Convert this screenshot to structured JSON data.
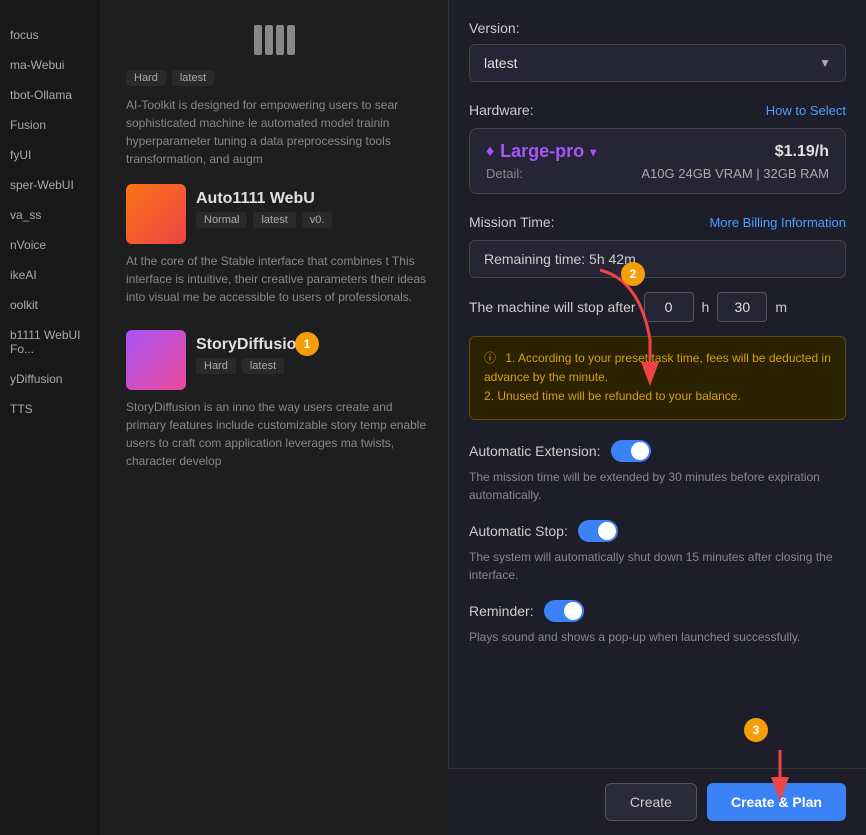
{
  "sidebar": {
    "items": [
      {
        "label": "focus"
      },
      {
        "label": "ma-Webui"
      },
      {
        "label": "tbot-Ollama"
      },
      {
        "label": "Fusion"
      },
      {
        "label": "fyUI"
      },
      {
        "label": "sper-WebUI"
      },
      {
        "label": "va_ss"
      },
      {
        "label": "nVoice"
      },
      {
        "label": "ikeAI"
      },
      {
        "label": "oolkit"
      },
      {
        "label": "b1111 WebUI Fo..."
      },
      {
        "label": "yDiffusion"
      },
      {
        "label": "TTS"
      }
    ]
  },
  "content": {
    "app1": {
      "title": "Auto1111 WebU",
      "tags": [
        "Normal",
        "latest",
        "v0."
      ],
      "description": "At the core of the Stable interface that combines t This interface is intuitive, their creative parameters their ideas into visual me be accessible to users of professionals."
    },
    "app2": {
      "title": "StoryDiffusion",
      "tags": [
        "Hard",
        "latest"
      ],
      "description": "StoryDiffusion is an inno the way users create and primary features include customizable story temp enable users to craft com application leverages ma twists, character develop"
    }
  },
  "right_panel": {
    "version_label": "Version:",
    "version_value": "latest",
    "hardware_label": "Hardware:",
    "how_to_select": "How to Select",
    "hardware_name": "Large-pro",
    "hardware_price": "$1.19/h",
    "detail_label": "Detail:",
    "detail_value": "A10G 24GB VRAM | 32GB RAM",
    "mission_time_label": "Mission Time:",
    "more_billing": "More Billing Information",
    "remaining_time": "Remaining time: 5h 42m",
    "stop_after_label": "The machine will stop after",
    "stop_hours": "0",
    "stop_minutes": "30",
    "hours_label": "h",
    "minutes_label": "m",
    "warning_line1": "1. According to your preset task time, fees will be deducted in advance by the minute.",
    "warning_line2": "2. Unused time will be refunded to your balance.",
    "auto_extension_label": "Automatic Extension:",
    "auto_extension_desc": "The mission time will be extended by 30 minutes before expiration automatically.",
    "auto_stop_label": "Automatic Stop:",
    "auto_stop_desc": "The system will automatically shut down 15 minutes after closing the interface.",
    "reminder_label": "Reminder:",
    "reminder_desc": "Plays sound and shows a pop-up when launched successfully.",
    "btn_create": "Create",
    "btn_create_plan": "Create & Plan"
  },
  "annotations": {
    "circle1_label": "1",
    "circle2_label": "2",
    "circle3_label": "3"
  }
}
